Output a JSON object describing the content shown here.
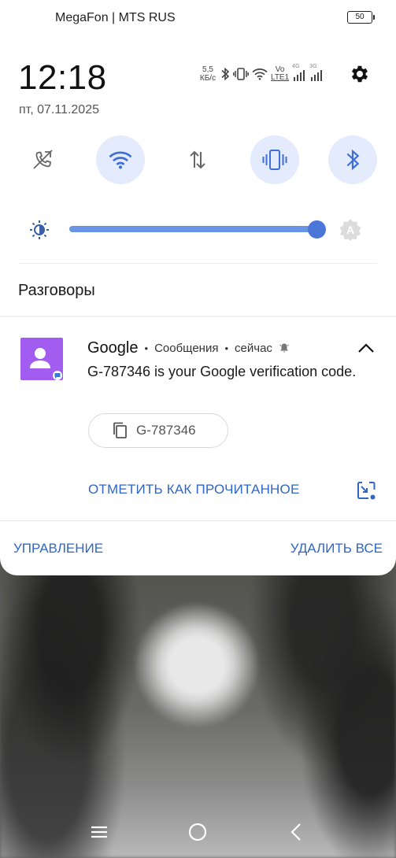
{
  "status_bar": {
    "carrier": "MegaFon | MTS RUS",
    "battery": "50"
  },
  "header": {
    "time": "12:18",
    "date": "пт, 07.11.2025",
    "net_speed_value": "5,5",
    "net_speed_unit": "КБ/с",
    "volte_top": "Vo",
    "volte_bottom": "LTE1",
    "sim1_type": "4G",
    "sim2_type": "3G"
  },
  "quick_settings": {
    "tiles": [
      {
        "name": "call-forward",
        "active": false
      },
      {
        "name": "wifi",
        "active": true
      },
      {
        "name": "mobile-data",
        "active": false
      },
      {
        "name": "vibrate",
        "active": true
      },
      {
        "name": "bluetooth",
        "active": true
      }
    ],
    "brightness_level": 0.98,
    "auto_brightness_label": "A"
  },
  "section": {
    "title": "Разговоры"
  },
  "notification": {
    "app_name": "Google",
    "separator": "•",
    "channel": "Сообщения",
    "time": "сейчас",
    "text": "G-787346 is your Google verification code.",
    "copy_code": "G-787346",
    "action_mark_read": "ОТМЕТИТЬ КАК ПРОЧИТАННОЕ"
  },
  "footer": {
    "manage": "УПРАВЛЕНИЕ",
    "clear_all": "УДАЛИТЬ ВСЕ"
  },
  "colors": {
    "accent": "#2f66c8",
    "tile_active_bg": "#e3ebfc",
    "app_icon_bg": "#a25cf0"
  }
}
